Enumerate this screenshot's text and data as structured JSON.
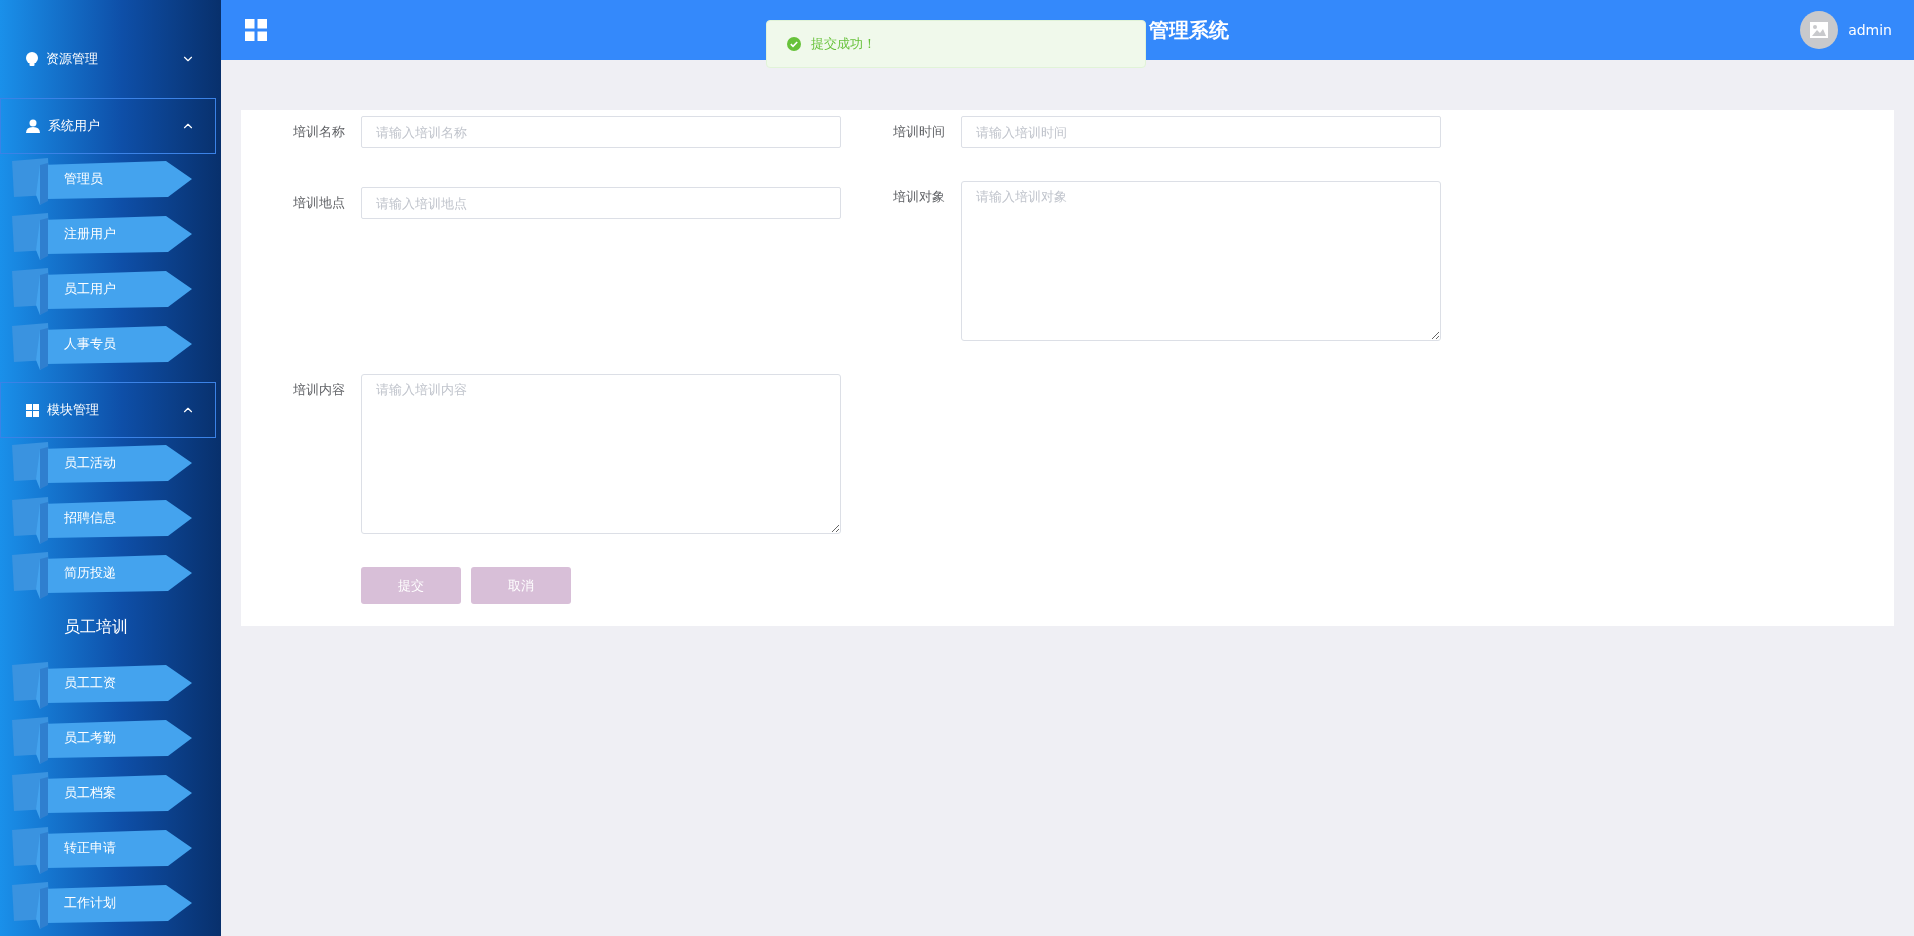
{
  "header": {
    "title": "管理系统",
    "user": "admin"
  },
  "toast": {
    "message": "提交成功！"
  },
  "sidebar": {
    "groups": [
      {
        "label": "资源管理",
        "expanded": false
      },
      {
        "label": "系统用户",
        "expanded": true,
        "children": [
          {
            "label": "管理员",
            "selected": false
          },
          {
            "label": "注册用户",
            "selected": false
          },
          {
            "label": "员工用户",
            "selected": false
          },
          {
            "label": "人事专员",
            "selected": false
          }
        ]
      },
      {
        "label": "模块管理",
        "expanded": true,
        "children": [
          {
            "label": "员工活动",
            "selected": false
          },
          {
            "label": "招聘信息",
            "selected": false
          },
          {
            "label": "简历投递",
            "selected": false
          },
          {
            "label": "员工培训",
            "selected": true
          },
          {
            "label": "员工工资",
            "selected": false
          },
          {
            "label": "员工考勤",
            "selected": false
          },
          {
            "label": "员工档案",
            "selected": false
          },
          {
            "label": "转正申请",
            "selected": false
          },
          {
            "label": "工作计划",
            "selected": false
          }
        ]
      }
    ]
  },
  "form": {
    "fields": [
      {
        "label": "培训名称",
        "placeholder": "请输入培训名称",
        "kind": "input"
      },
      {
        "label": "培训时间",
        "placeholder": "请输入培训时间",
        "kind": "input"
      },
      {
        "label": "培训地点",
        "placeholder": "请输入培训地点",
        "kind": "input"
      },
      {
        "label": "培训对象",
        "placeholder": "请输入培训对象",
        "kind": "textarea"
      },
      {
        "label": "培训内容",
        "placeholder": "请输入培训内容",
        "kind": "textarea"
      }
    ],
    "buttons": [
      {
        "label": "提交"
      },
      {
        "label": "取消"
      }
    ]
  }
}
